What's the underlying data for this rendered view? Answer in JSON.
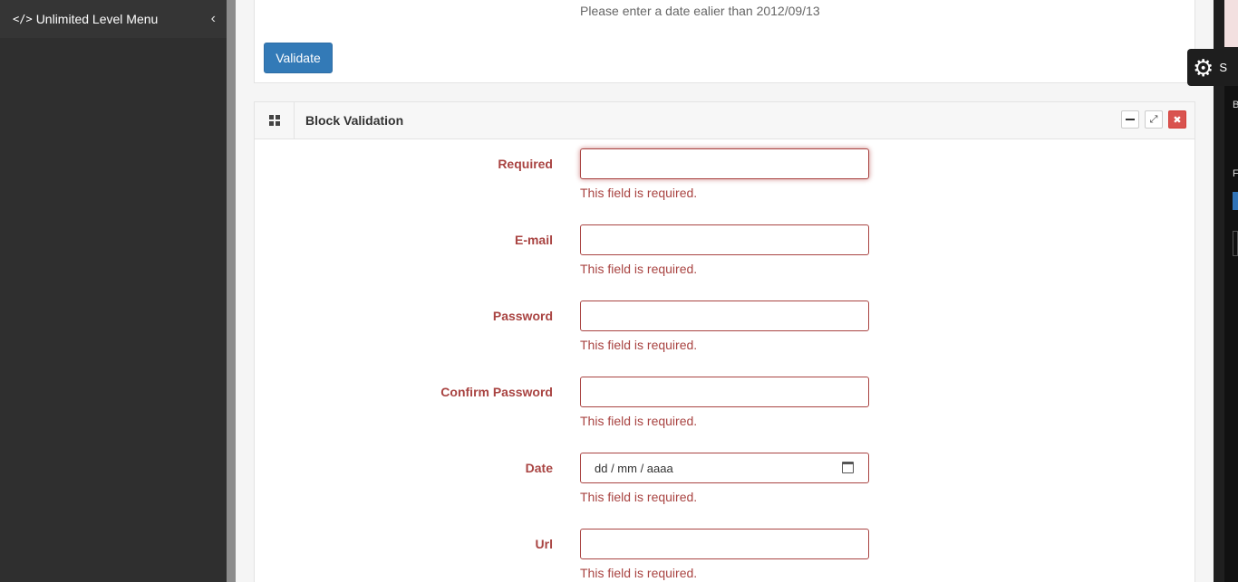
{
  "sidebar": {
    "menu_icon": "</>",
    "title": "Unlimited Level Menu",
    "collapse_icon": "‹"
  },
  "top_panel": {
    "message": "Please enter a date ealier than 2012/09/13",
    "validate_label": "Validate"
  },
  "settings_tab": {
    "icon": "gear-icon",
    "label": "S"
  },
  "right_panel": {
    "letter_b": "B",
    "letter_f": "F"
  },
  "block": {
    "title": "Block Validation",
    "icons": [
      "grid-icon",
      "minimize-icon",
      "expand-icon",
      "close-icon"
    ],
    "fields": [
      {
        "label": "Required",
        "value": "",
        "error": "This field is required."
      },
      {
        "label": "E-mail",
        "value": "",
        "error": "This field is required."
      },
      {
        "label": "Password",
        "value": "",
        "error": "This field is required."
      },
      {
        "label": "Confirm Password",
        "value": "",
        "error": "This field is required."
      },
      {
        "label": "Date",
        "placeholder": "dd / mm / aaaa",
        "error": "This field is required."
      },
      {
        "label": "Url",
        "value": "",
        "error": "This field is required."
      }
    ]
  },
  "colors": {
    "error": "#a94442",
    "primary": "#337ab7",
    "danger": "#d9534f",
    "sidebar_bg": "#2f2f2f"
  }
}
